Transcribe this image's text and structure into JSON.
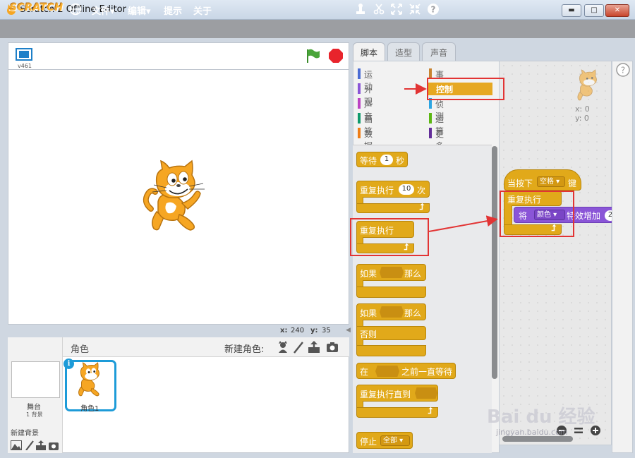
{
  "window": {
    "title": "Scratch 2 Offline Editor",
    "min_label": "▬",
    "max_label": "□",
    "close_label": "✕"
  },
  "menubar": {
    "logo": "SCRATCH",
    "file": "文件▾",
    "edit": "编辑▾",
    "tips": "提示",
    "about": "关于",
    "tools": [
      "stamp-icon",
      "cut-icon",
      "grow-icon",
      "shrink-icon",
      "help-circle-icon"
    ]
  },
  "stage": {
    "version": "v461",
    "x_label": "x:",
    "x_value": "240",
    "y_label": "y:",
    "y_value": "35"
  },
  "sprites": {
    "title": "角色",
    "new_sprite_label": "新建角色:",
    "stage_label": "舞台",
    "stage_backdrops": "1 背景",
    "new_backdrop_label": "新建背景",
    "sprite_name": "角色1"
  },
  "tabs": {
    "scripts": "脚本",
    "costumes": "造型",
    "sounds": "声音"
  },
  "categories": {
    "left": [
      {
        "label": "运动",
        "color": "#4a6cd4"
      },
      {
        "label": "外观",
        "color": "#8a55d7"
      },
      {
        "label": "声音",
        "color": "#bb42c3"
      },
      {
        "label": "画笔",
        "color": "#0e9a6c"
      },
      {
        "label": "数据",
        "color": "#ee7d16"
      }
    ],
    "right": [
      {
        "label": "事件",
        "color": "#c88330"
      },
      {
        "label": "控制",
        "color": "#e1a91a"
      },
      {
        "label": "侦测",
        "color": "#2ca5e2"
      },
      {
        "label": "运算",
        "color": "#5cb712"
      },
      {
        "label": "更多积木",
        "color": "#632d99"
      }
    ]
  },
  "blocks": {
    "wait_pre": "等待",
    "wait_val": "1",
    "wait_post": "秒",
    "repeat_pre": "重复执行",
    "repeat_val": "10",
    "repeat_post": "次",
    "forever": "重复执行",
    "if_pre": "如果",
    "if_post": "那么",
    "else": "否则",
    "wait_until_pre": "在",
    "wait_until_post": "之前一直等待",
    "repeat_until": "重复执行直到",
    "stop": "停止",
    "stop_val": "全部"
  },
  "script": {
    "hat_pre": "当按下",
    "hat_key": "空格",
    "hat_post": "键",
    "forever": "重复执行",
    "effect_pre": "将",
    "effect_name": "颜色",
    "effect_post": "特效增加",
    "effect_val": "2",
    "x_label": "x: 0",
    "y_label": "y: 0"
  },
  "colors": {
    "control": "#e1a91a",
    "looks": "#8a55d7",
    "annotation": "#e23434",
    "selection": "#1d9bd8"
  },
  "watermark": {
    "brand": "Bai du 经验",
    "url": "jingyan.baidu.com"
  }
}
